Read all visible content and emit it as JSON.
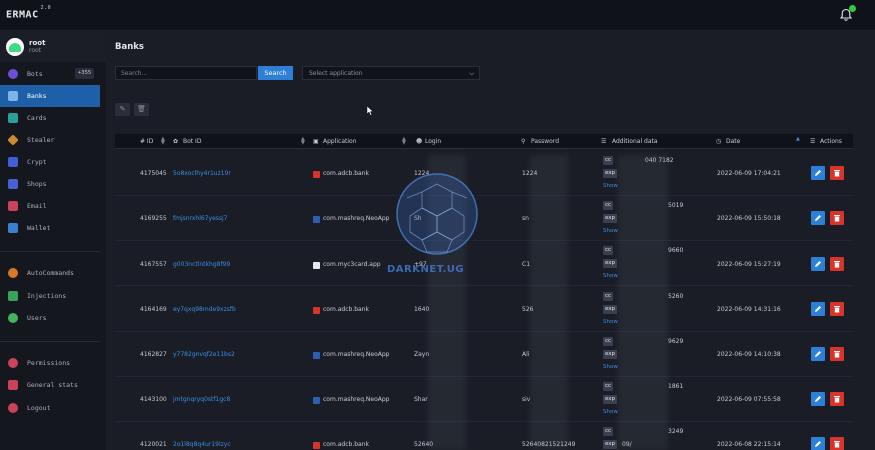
{
  "app": {
    "name": "ERMAC",
    "version": "2.0"
  },
  "colors": {
    "accent": "#2d7fd7",
    "danger": "#d9342b",
    "link": "#3a8ee6",
    "active_nav": "#1f5fa8"
  },
  "user": {
    "name": "root",
    "role": "root"
  },
  "sidebar": {
    "items": [
      {
        "label": "Bots",
        "icon": "robot-icon",
        "badge": "+355"
      },
      {
        "label": "Banks",
        "icon": "bank-icon"
      },
      {
        "label": "Cards",
        "icon": "card-icon"
      },
      {
        "label": "Stealer",
        "icon": "stealer-icon"
      },
      {
        "label": "Crypt",
        "icon": "crypt-icon"
      },
      {
        "label": "Shops",
        "icon": "shop-icon"
      },
      {
        "label": "Email",
        "icon": "email-icon"
      },
      {
        "label": "Wallet",
        "icon": "wallet-icon"
      },
      {
        "label": "AutoCommands",
        "icon": "autocommands-icon"
      },
      {
        "label": "Injections",
        "icon": "injections-icon"
      },
      {
        "label": "Users",
        "icon": "users-icon"
      },
      {
        "label": "Permissions",
        "icon": "permissions-icon"
      },
      {
        "label": "General stats",
        "icon": "stats-icon"
      },
      {
        "label": "Logout",
        "icon": "logout-icon"
      }
    ]
  },
  "main": {
    "title": "Banks",
    "search": {
      "placeholder": "Search...",
      "button": "Search"
    },
    "select": {
      "placeholder": "Select application"
    }
  },
  "table": {
    "headers": {
      "id": "# ID",
      "bot_id": "Bot ID",
      "application": "Application",
      "login": "Login",
      "password": "Password",
      "additional": "Additional data",
      "date": "Date",
      "actions": "Actions"
    },
    "tags": {
      "cc": "cc",
      "exp": "exp",
      "show": "Show"
    },
    "rows": [
      {
        "id": "4175045",
        "bot_id": "5o8xoclhy4r1uz19r",
        "app": "com.adcb.bank",
        "login": "1224",
        "password": "1224",
        "cc_tail": "040 7182",
        "date": "2022-06-09 17:04:21"
      },
      {
        "id": "4169255",
        "bot_id": "fmjsnrxhl67yessj7",
        "app": "com.mashreq.NeoApp",
        "login": "Sh",
        "password": "sn",
        "cc_tail": "5019",
        "date": "2022-06-09 15:50:18"
      },
      {
        "id": "4167557",
        "bot_id": "g003nctlntkhg8f99",
        "app": "com.myc3card.app",
        "login": "+97",
        "password": "C1",
        "cc_tail": "9660",
        "date": "2022-06-09 15:27:19"
      },
      {
        "id": "4164169",
        "bot_id": "ey7qxq98mde9xzsfb",
        "app": "com.adcb.bank",
        "login": "1640",
        "password": "526",
        "cc_tail": "5260",
        "date": "2022-06-09 14:31:16"
      },
      {
        "id": "4162827",
        "bot_id": "y7782gnvqf2e11bs2",
        "app": "com.mashreq.NeoApp",
        "login": "Zayn",
        "password": "Ali",
        "cc_tail": "9629",
        "date": "2022-06-09 14:10:38"
      },
      {
        "id": "4143100",
        "bot_id": "jmtgnqryq0stf1gc8",
        "app": "com.mashreq.NeoApp",
        "login": "Shar",
        "password": "siv",
        "cc_tail": "1861",
        "date": "2022-06-09 07:55:58"
      },
      {
        "id": "4120021",
        "bot_id": "2o1l8q8q4ur19lzyc",
        "app": "com.adcb.bank",
        "login": "52640",
        "password": "52640821521249",
        "cc_tail": "3249",
        "exp_tail": "09/",
        "date": "2022-06-08 22:15:14"
      }
    ]
  },
  "watermark": "DARKNET.UG"
}
